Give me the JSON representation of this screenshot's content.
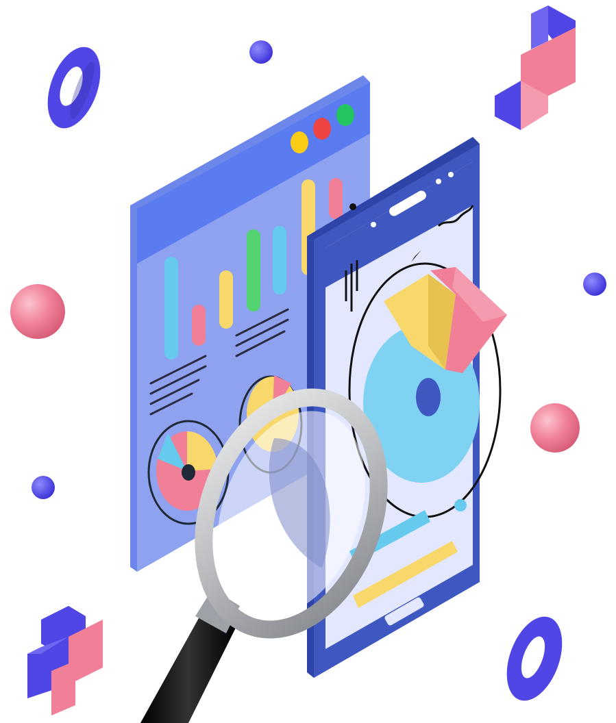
{
  "illustration": {
    "palette": {
      "background": "#ffffff",
      "indigo": "#4f46e5",
      "indigo_dark": "#3730a3",
      "panel_blue": "#8ea2ef",
      "panel_top": "#5b7cf0",
      "phone_frame": "#3f57c0",
      "phone_screen": "#e3e8ff",
      "pink": "#f07f97",
      "yellow": "#f8d76b",
      "cyan": "#66c9ee",
      "green": "#52d36f",
      "dot_red": "#ef4444",
      "dot_yellow": "#facc15",
      "dot_green": "#22c55e",
      "glass_frame": "#c7c9cc",
      "handle": "#111111"
    },
    "window_controls": [
      "dot-yellow",
      "dot-red",
      "dot-green"
    ],
    "decorations": [
      "ring-top-left",
      "dot-top",
      "stairs-top-right",
      "sphere-left",
      "dot-right",
      "sphere-right",
      "dot-left",
      "cross-bottom-left",
      "ring-bottom-right"
    ],
    "icons": [
      "magnifying-glass-icon",
      "bar-chart-icon",
      "pie-chart-icon",
      "donut-chart-icon",
      "trend-line-icon"
    ]
  }
}
